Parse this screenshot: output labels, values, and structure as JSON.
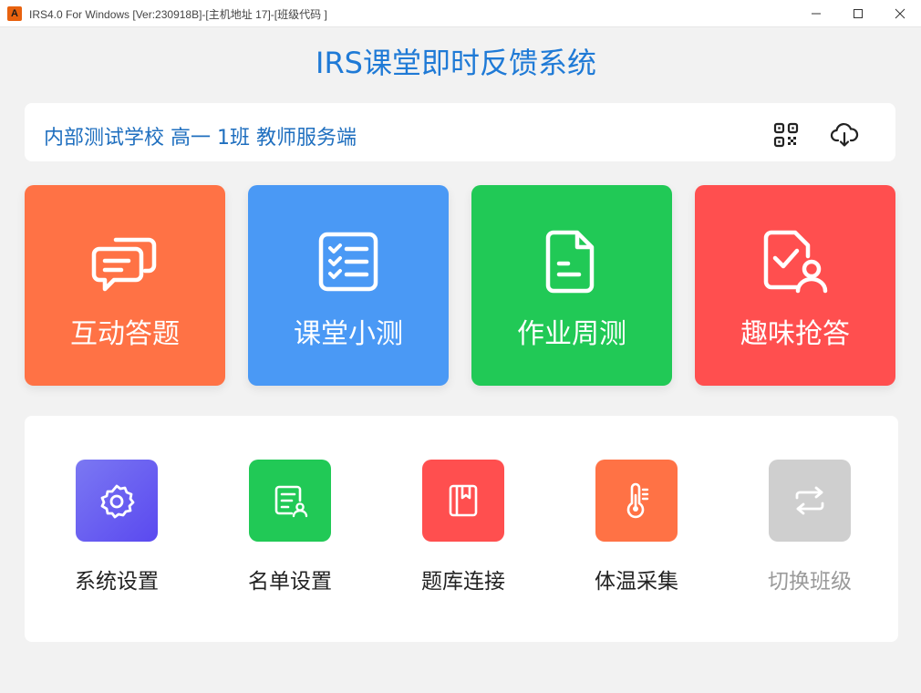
{
  "window": {
    "app_icon_letter": "A",
    "title": "IRS4.0 For Windows [Ver:230918B]-[主机地址 17]-[班级代码 ]",
    "controls": {
      "minimize": "—",
      "maximize": "☐",
      "close": "✕"
    }
  },
  "header": {
    "title": "IRS课堂即时反馈系统"
  },
  "info_bar": {
    "school_line": "内部测试学校 高一 1班 教师服务端",
    "icons": [
      "qr-code-icon",
      "cloud-download-icon"
    ]
  },
  "main_tiles": [
    {
      "label": "互动答题",
      "icon": "chat-bubbles-icon",
      "color": "#ff7245"
    },
    {
      "label": "课堂小测",
      "icon": "checklist-icon",
      "color": "#4a99f5"
    },
    {
      "label": "作业周测",
      "icon": "document-icon",
      "color": "#21c956"
    },
    {
      "label": "趣味抢答",
      "icon": "user-check-icon",
      "color": "#ff4f4f"
    }
  ],
  "tools": [
    {
      "label": "系统设置",
      "icon": "gear-icon",
      "color": "#5a5cf0"
    },
    {
      "label": "名单设置",
      "icon": "roster-icon",
      "color": "#21c956"
    },
    {
      "label": "题库连接",
      "icon": "book-icon",
      "color": "#ff4f4f"
    },
    {
      "label": "体温采集",
      "icon": "thermometer-icon",
      "color": "#ff7245"
    },
    {
      "label": "切换班级",
      "icon": "switch-arrows-icon",
      "color": "#cfcfcf"
    }
  ]
}
